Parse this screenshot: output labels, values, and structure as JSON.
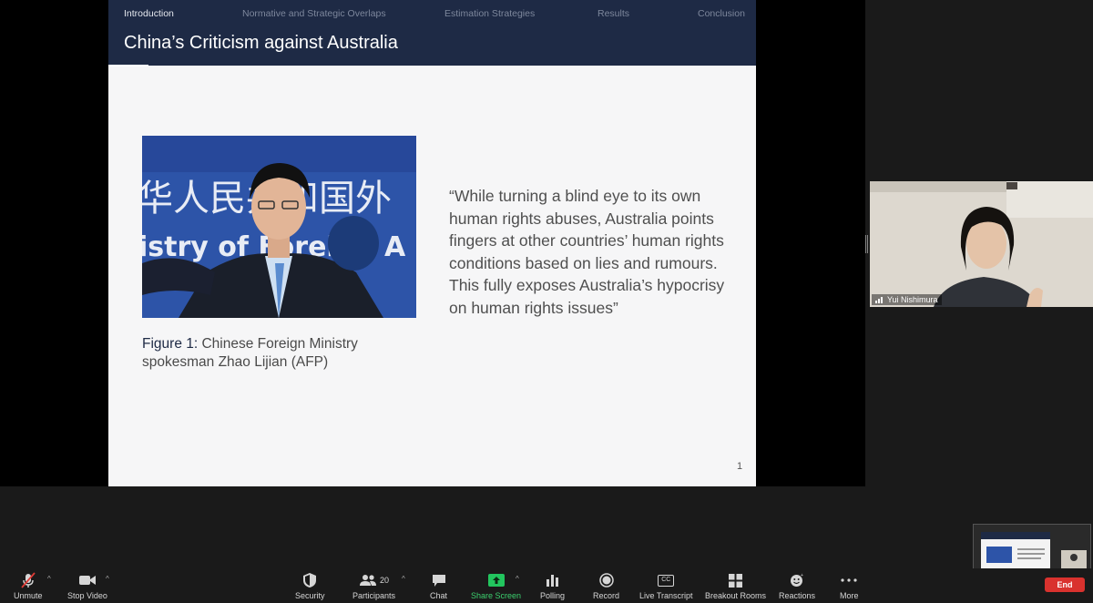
{
  "slide": {
    "nav": [
      "Introduction",
      "Normative and Strategic Overlaps",
      "Estimation Strategies",
      "Results",
      "Conclusion"
    ],
    "title": "China’s Criticism against Australia",
    "photo_text_top": "华人民共和国外",
    "photo_text_bottom": "istry of Foreign A",
    "caption_label": "Figure 1:",
    "caption_text": "Chinese Foreign Ministry spokesman Zhao Lijian (AFP)",
    "quote": "“While turning a blind eye to its own human rights abuses, Australia points fingers at other countries’ human rights conditions based on lies and rumours. This fully exposes Australia’s hypocrisy on human rights issues”",
    "page_number": "1"
  },
  "participant": {
    "name": "Yui Nishimura"
  },
  "toolbar": {
    "unmute": "Unmute",
    "stop_video": "Stop Video",
    "security": "Security",
    "participants": "Participants",
    "participants_count": "20",
    "chat": "Chat",
    "share_screen": "Share Screen",
    "polling": "Polling",
    "record": "Record",
    "live_transcript": "Live Transcript",
    "cc": "CC",
    "breakout_rooms": "Breakout Rooms",
    "reactions": "Reactions",
    "more": "More",
    "end": "End"
  },
  "colors": {
    "slide_header": "#1e2a45",
    "share_green": "#22c55e",
    "end_red": "#d9322e"
  }
}
